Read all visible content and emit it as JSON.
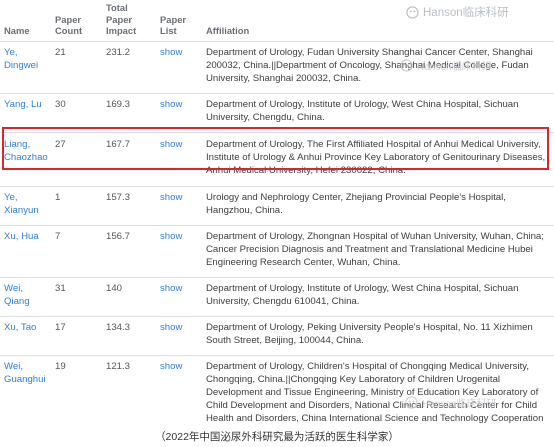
{
  "watermark": {
    "text": "Hanson临床科研"
  },
  "table": {
    "headers": {
      "name": "Name",
      "paper_count": "Paper Count",
      "total_paper_impact": "Total Paper Impact",
      "paper_list": "Paper List",
      "affiliation": "Affiliation"
    },
    "rows": [
      {
        "name": "Ye, Dingwei",
        "paper_count": "21",
        "impact": "231.2",
        "list": "show",
        "affiliation": "Department of Urology, Fudan University Shanghai Cancer Center, Shanghai 200032, China.||Department of Oncology, Shanghai Medical College, Fudan University, Shanghai 200032, China."
      },
      {
        "name": "Yang, Lu",
        "paper_count": "30",
        "impact": "169.3",
        "list": "show",
        "affiliation": "Department of Urology, Institute of Urology, West China Hospital, Sichuan University, Chengdu, China."
      },
      {
        "name": "Liang, Chaozhao",
        "paper_count": "27",
        "impact": "167.7",
        "list": "show",
        "affiliation": "Department of Urology, The First Affiliated Hospital of Anhui Medical University, Institute of Urology & Anhui Province Key Laboratory of Genitourinary Diseases, Anhui Medical University, Hefei 230022, China."
      },
      {
        "name": "Ye, Xianyun",
        "paper_count": "1",
        "impact": "157.3",
        "list": "show",
        "affiliation": "Urology and Nephrology Center, Zhejiang Provincial People's Hospital, Hangzhou, China."
      },
      {
        "name": "Xu, Hua",
        "paper_count": "7",
        "impact": "156.7",
        "list": "show",
        "affiliation": "Department of Urology, Zhongnan Hospital of Wuhan University, Wuhan, China; Cancer Precision Diagnosis and Treatment and Translational Medicine Hubei Engineering Research Center, Wuhan, China."
      },
      {
        "name": "Wei, Qiang",
        "paper_count": "31",
        "impact": "140",
        "list": "show",
        "affiliation": "Department of Urology, Institute of Urology, West China Hospital, Sichuan University, Chengdu 610041, China."
      },
      {
        "name": "Xu, Tao",
        "paper_count": "17",
        "impact": "134.3",
        "list": "show",
        "affiliation": "Department of Urology, Peking University People's Hospital, No. 11 Xizhimen South Street, Beijing, 100044, China."
      },
      {
        "name": "Wei, Guanghui",
        "paper_count": "19",
        "impact": "121.3",
        "list": "show",
        "affiliation": "Department of Urology, Children's Hospital of Chongqing Medical University, Chongqing, China.||Chongqing Key Laboratory of Children Urogenital Development and Tissue Engineering, Ministry of Education Key Laboratory of Child Development and Disorders, National Clinical Research Center for Child Health and Disorders, China International Science and Technology Cooperation Base of Child Development and Critical Disorders, Chongqing Key Laboratory of Pediatrics, Chongqing, China."
      }
    ]
  },
  "caption": "（2022年中国泌尿外科研究最为活跃的医生科学家）",
  "colors": {
    "link": "#2f7fd1",
    "highlight_border": "#d9252b"
  }
}
